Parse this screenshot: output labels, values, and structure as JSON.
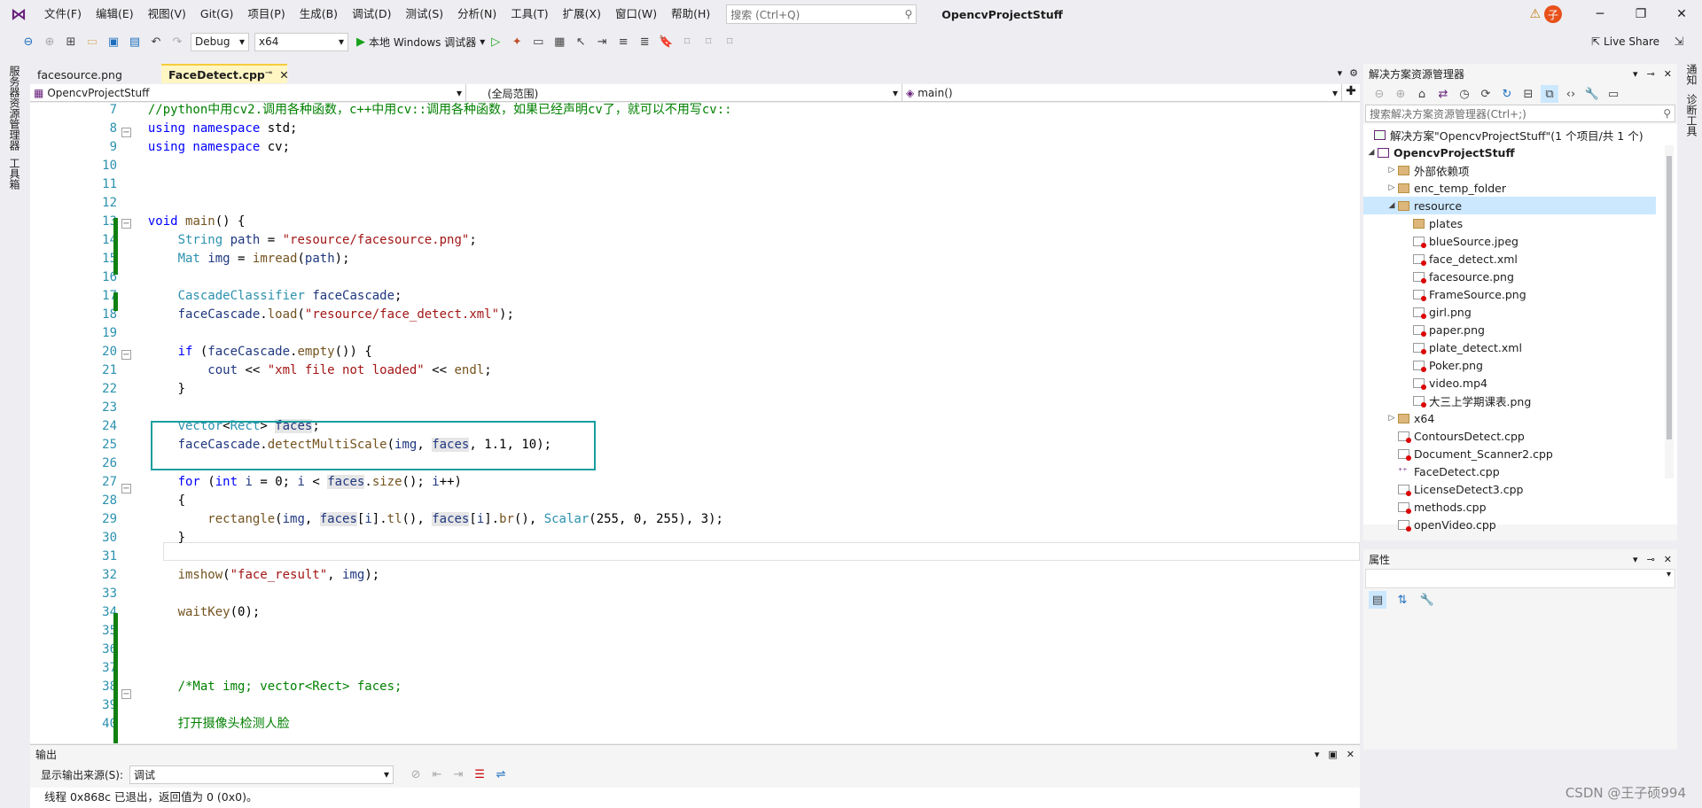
{
  "menubar": {
    "items": [
      "文件(F)",
      "编辑(E)",
      "视图(V)",
      "Git(G)",
      "项目(P)",
      "生成(B)",
      "调试(D)",
      "测试(S)",
      "分析(N)",
      "工具(T)",
      "扩展(X)",
      "窗口(W)",
      "帮助(H)"
    ],
    "search_placeholder": "搜索 (Ctrl+Q)",
    "project_title": "OpencvProjectStuff",
    "avatar_letter": "子"
  },
  "toolbar": {
    "config": "Debug",
    "platform": "x64",
    "run_label": "本地 Windows 调试器",
    "live_share": "Live Share"
  },
  "left_strip": {
    "item1": "服务器资源管理器",
    "item2": "工具箱"
  },
  "right_strip": {
    "item1": "通知",
    "item2": "诊断工具"
  },
  "tabs": [
    {
      "label": "facesource.png",
      "active": false
    },
    {
      "label": "FaceDetect.cpp",
      "active": true
    }
  ],
  "navbar": {
    "project": "OpencvProjectStuff",
    "scope": "(全局范围)",
    "member": "main()"
  },
  "editor": {
    "line_numbers": [
      "7",
      "8",
      "9",
      "10",
      "11",
      "12",
      "13",
      "14",
      "15",
      "16",
      "17",
      "18",
      "19",
      "20",
      "21",
      "22",
      "23",
      "24",
      "25",
      "26",
      "27",
      "28",
      "29",
      "30",
      "31",
      "32",
      "33",
      "34",
      "35",
      "36",
      "37",
      "38",
      "39",
      "40"
    ]
  },
  "solution_explorer": {
    "title": "解决方案资源管理器",
    "search_placeholder": "搜索解决方案资源管理器(Ctrl+;)",
    "solution": "解决方案\"OpencvProjectStuff\"(1 个项目/共 1 个)",
    "project": "OpencvProjectStuff",
    "items": [
      {
        "label": "外部依赖项",
        "kind": "ref"
      },
      {
        "label": "enc_temp_folder",
        "kind": "folder"
      },
      {
        "label": "resource",
        "kind": "folder"
      },
      {
        "label": "plates",
        "kind": "folder"
      },
      {
        "label": "blueSource.jpeg",
        "kind": "file"
      },
      {
        "label": "face_detect.xml",
        "kind": "file"
      },
      {
        "label": "facesource.png",
        "kind": "file"
      },
      {
        "label": "FrameSource.png",
        "kind": "file"
      },
      {
        "label": "girl.png",
        "kind": "file"
      },
      {
        "label": "paper.png",
        "kind": "file"
      },
      {
        "label": "plate_detect.xml",
        "kind": "file"
      },
      {
        "label": "Poker.png",
        "kind": "file"
      },
      {
        "label": "video.mp4",
        "kind": "file"
      },
      {
        "label": "大三上学期课表.png",
        "kind": "file"
      },
      {
        "label": "x64",
        "kind": "folder"
      },
      {
        "label": "ContoursDetect.cpp",
        "kind": "file"
      },
      {
        "label": "Document_Scanner2.cpp",
        "kind": "file"
      },
      {
        "label": "FaceDetect.cpp",
        "kind": "cpp"
      },
      {
        "label": "LicenseDetect3.cpp",
        "kind": "file"
      },
      {
        "label": "methods.cpp",
        "kind": "file"
      },
      {
        "label": "openVideo.cpp",
        "kind": "file"
      }
    ]
  },
  "properties": {
    "title": "属性"
  },
  "output": {
    "title": "输出",
    "source_label": "显示输出来源(S):",
    "source_value": "调试",
    "line1": "线程 0x868c 已退出，返回值为 0 (0x0)。"
  },
  "watermark": "CSDN @王子硕994"
}
